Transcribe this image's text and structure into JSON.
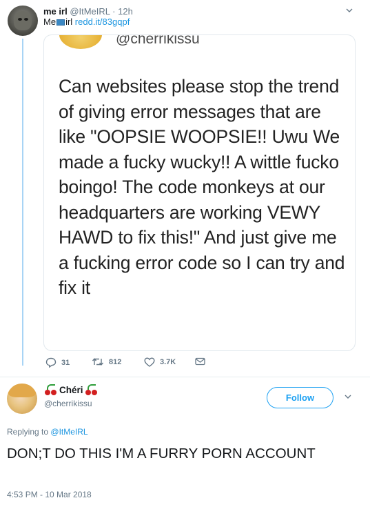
{
  "tweet1": {
    "name": "me irl",
    "handle": "@ItMeIRL",
    "time": "· 12h",
    "text_pre": "Me",
    "text_post": "irl",
    "link": "redd.it/83gqpf",
    "media": {
      "top_handle": "@cherrikissu",
      "body": "Can websites please stop the trend of giving error messages that are like \"OOPSIE WOOPSIE!! Uwu We made a fucky wucky!! A wittle fucko boingo! The code monkeys at our headquarters are working VEWY HAWD to fix this!\" And just give me a fucking error code so I can try and fix it"
    },
    "actions": {
      "replies": "31",
      "retweets": "812",
      "likes": "3.7K"
    }
  },
  "tweet2": {
    "name": "Chéri",
    "handle": "@cherrikissu",
    "follow_label": "Follow",
    "replying_prefix": "Replying to",
    "replying_mention": "@ItMeIRL",
    "body": "DON;T DO THIS I'M A FURRY PORN ACCOUNT",
    "timestamp": "4:53 PM - 10 Mar 2018"
  },
  "colors": {
    "accent": "#1da1f2",
    "link": "#1b95e0",
    "muted": "#657786",
    "thread_line": "#a8d4f5"
  },
  "icons": [
    "chevron-down-icon",
    "reply-icon",
    "retweet-icon",
    "heart-icon",
    "envelope-icon",
    "laptop-icon",
    "cherry-icon"
  ]
}
